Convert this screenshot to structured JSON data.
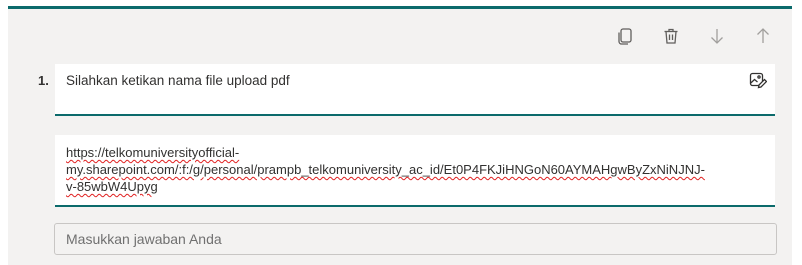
{
  "toolbar": {
    "actions": [
      {
        "name": "copy-icon"
      },
      {
        "name": "delete-icon"
      },
      {
        "name": "arrow-down-icon"
      },
      {
        "name": "arrow-up-icon"
      }
    ]
  },
  "question": {
    "number": "1.",
    "text": "Silahkan ketikan nama file upload pdf",
    "media_icon": "image-edit-icon"
  },
  "answer": {
    "line1": "https://telkomuniversityofficial-",
    "line2": "my.sharepoint.com/:f:/g/personal/prampb_telkomuniversity_ac_id/Et0P4FKJiHNGoN60AYMAHgwByZxNiNJNJ-",
    "line3": "v-85wbW4Upyg"
  },
  "response": {
    "placeholder": "Masukkan jawaban Anda"
  },
  "colors": {
    "accent": "#0b6a6b",
    "card_background": "#f3f2f1",
    "icon": "#605e5c",
    "icon_disabled": "#a19f9d"
  }
}
